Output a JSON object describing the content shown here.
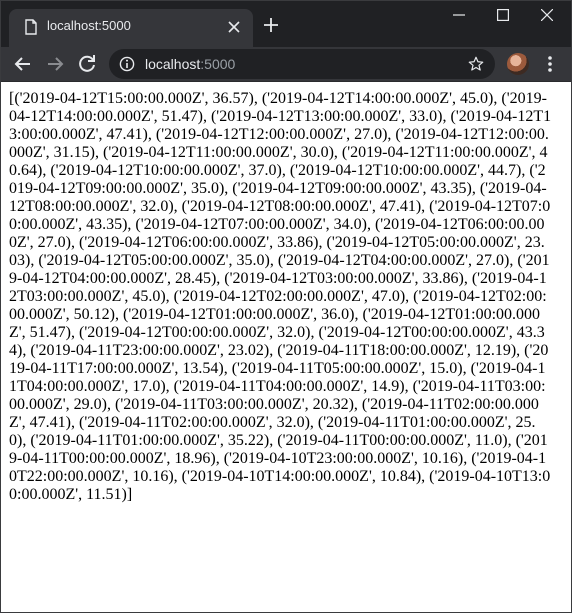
{
  "colors": {
    "titlebar_bg": "#202124",
    "tab_bg": "#35363a",
    "toolbar_bg": "#35363a",
    "omnibox_bg": "#202124",
    "text_light": "#e8eaed",
    "text_dim": "#9aa0a6"
  },
  "tab": {
    "favicon_icon": "page-icon",
    "title": "localhost:5000",
    "close_icon": "close-icon"
  },
  "toolbar": {
    "back_icon": "arrow-left-icon",
    "forward_icon": "arrow-right-icon",
    "reload_icon": "reload-icon",
    "omnibox": {
      "info_icon": "info-icon",
      "host": "localhost",
      "port": ":5000",
      "star_icon": "star-icon"
    },
    "menu_icon": "kebab-menu-icon"
  },
  "page": {
    "text": "[('2019-04-12T15:00:00.000Z', 36.57), ('2019-04-12T14:00:00.000Z', 45.0), ('2019-04-12T14:00:00.000Z', 51.47), ('2019-04-12T13:00:00.000Z', 33.0), ('2019-04-12T13:00:00.000Z', 47.41), ('2019-04-12T12:00:00.000Z', 27.0), ('2019-04-12T12:00:00.000Z', 31.15), ('2019-04-12T11:00:00.000Z', 30.0), ('2019-04-12T11:00:00.000Z', 40.64), ('2019-04-12T10:00:00.000Z', 37.0), ('2019-04-12T10:00:00.000Z', 44.7), ('2019-04-12T09:00:00.000Z', 35.0), ('2019-04-12T09:00:00.000Z', 43.35), ('2019-04-12T08:00:00.000Z', 32.0), ('2019-04-12T08:00:00.000Z', 47.41), ('2019-04-12T07:00:00.000Z', 43.35), ('2019-04-12T07:00:00.000Z', 34.0), ('2019-04-12T06:00:00.000Z', 27.0), ('2019-04-12T06:00:00.000Z', 33.86), ('2019-04-12T05:00:00.000Z', 23.03), ('2019-04-12T05:00:00.000Z', 35.0), ('2019-04-12T04:00:00.000Z', 27.0), ('2019-04-12T04:00:00.000Z', 28.45), ('2019-04-12T03:00:00.000Z', 33.86), ('2019-04-12T03:00:00.000Z', 45.0), ('2019-04-12T02:00:00.000Z', 47.0), ('2019-04-12T02:00:00.000Z', 50.12), ('2019-04-12T01:00:00.000Z', 36.0), ('2019-04-12T01:00:00.000Z', 51.47), ('2019-04-12T00:00:00.000Z', 32.0), ('2019-04-12T00:00:00.000Z', 43.34), ('2019-04-11T23:00:00.000Z', 23.02), ('2019-04-11T18:00:00.000Z', 12.19), ('2019-04-11T17:00:00.000Z', 13.54), ('2019-04-11T05:00:00.000Z', 15.0), ('2019-04-11T04:00:00.000Z', 17.0), ('2019-04-11T04:00:00.000Z', 14.9), ('2019-04-11T03:00:00.000Z', 29.0), ('2019-04-11T03:00:00.000Z', 20.32), ('2019-04-11T02:00:00.000Z', 47.41), ('2019-04-11T02:00:00.000Z', 32.0), ('2019-04-11T01:00:00.000Z', 25.0), ('2019-04-11T01:00:00.000Z', 35.22), ('2019-04-11T00:00:00.000Z', 11.0), ('2019-04-11T00:00:00.000Z', 18.96), ('2019-04-10T23:00:00.000Z', 10.16), ('2019-04-10T22:00:00.000Z', 10.16), ('2019-04-10T14:00:00.000Z', 10.84), ('2019-04-10T13:00:00.000Z', 11.51)]"
  }
}
